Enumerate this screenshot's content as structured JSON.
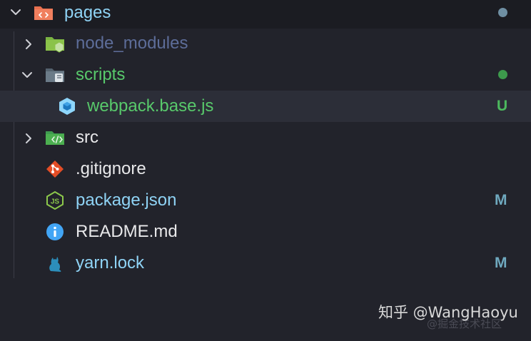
{
  "tree": {
    "root": {
      "label": "pages",
      "icon": "folder-src-icon",
      "status_dot_color": "#6f8fa3",
      "label_color": "#8fd3f5"
    },
    "items": [
      {
        "label": "node_modules",
        "icon": "folder-node-icon",
        "label_color": "#5d6d99",
        "expanded": false
      },
      {
        "label": "scripts",
        "icon": "folder-scripts-icon",
        "label_color": "#58c96b",
        "expanded": true,
        "status_dot_color": "#3d9a4c"
      },
      {
        "label": "webpack.base.js",
        "icon": "webpack-icon",
        "label_color": "#58c96b",
        "status": "U",
        "status_color": "#4cba5e",
        "selected": true
      },
      {
        "label": "src",
        "icon": "folder-src-code-icon",
        "label_color": "#e8e8ea",
        "expanded": false
      },
      {
        "label": ".gitignore",
        "icon": "git-icon",
        "label_color": "#e8e8ea"
      },
      {
        "label": "package.json",
        "icon": "nodejs-icon",
        "label_color": "#8fd3f5",
        "status": "M",
        "status_color": "#6fa9bf"
      },
      {
        "label": "README.md",
        "icon": "info-icon",
        "label_color": "#e8e8ea"
      },
      {
        "label": "yarn.lock",
        "icon": "yarn-cat-icon",
        "label_color": "#8fd3f5",
        "status": "M",
        "status_color": "#6fa9bf"
      }
    ]
  },
  "watermark": {
    "text": "知乎 @WangHaoyu",
    "subtext": "@掘金技术社区"
  }
}
